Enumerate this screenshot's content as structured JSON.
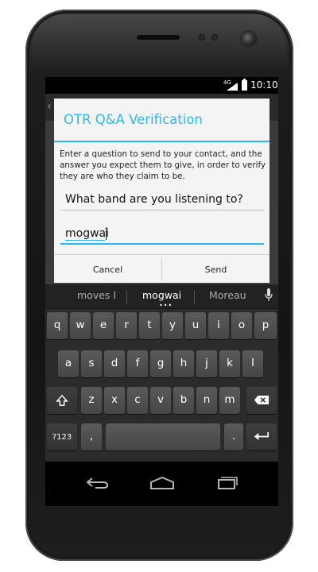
{
  "status_bar": {
    "network": "4G",
    "time": "10:10"
  },
  "dialog": {
    "title": "OTR Q&A Verification",
    "message": "Enter a question to send to your contact, and the answer you expect them to give, in order to verify they are who they claim to be.",
    "question_value": "What band are you listening to?",
    "answer_value": "mogwai",
    "cancel_label": "Cancel",
    "send_label": "Send"
  },
  "keyboard": {
    "suggestions": [
      "moves I",
      "mogwai",
      "Moreau"
    ],
    "row1": [
      "q",
      "w",
      "e",
      "r",
      "t",
      "y",
      "u",
      "i",
      "o",
      "p"
    ],
    "row2": [
      "a",
      "s",
      "d",
      "f",
      "g",
      "h",
      "j",
      "k",
      "l"
    ],
    "row3": [
      "z",
      "x",
      "c",
      "v",
      "b",
      "n",
      "m"
    ],
    "symbols_label": "?123",
    "comma_label": ",",
    "period_label": "."
  },
  "icons": {
    "shift": "shift-icon",
    "delete": "backspace-icon",
    "enter": "enter-icon",
    "mic": "microphone-icon",
    "back": "back-icon",
    "home": "home-icon",
    "recents": "recent-apps-icon"
  },
  "colors": {
    "accent": "#33b5e5",
    "dialog_bg": "#f4f4f4",
    "key_bg": "#505050"
  }
}
